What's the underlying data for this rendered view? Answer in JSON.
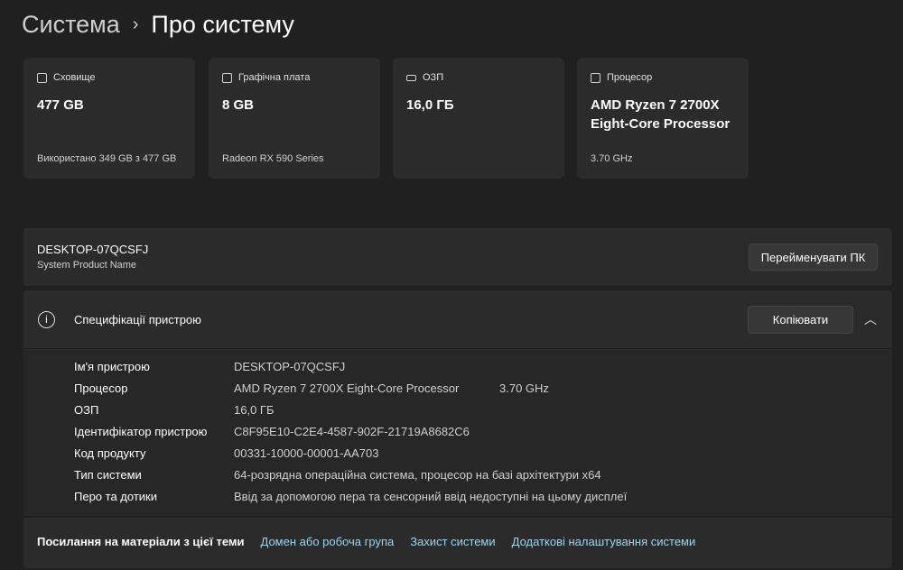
{
  "breadcrumb": {
    "parent": "Система",
    "current": "Про систему"
  },
  "cards": [
    {
      "icon": "storage-icon",
      "label": "Сховище",
      "value": "477 GB",
      "sub": "Використано 349 GB з 477 GB"
    },
    {
      "icon": "graphics-card-icon",
      "label": "Графічна плата",
      "value": "8 GB",
      "sub": "Radeon RX 590 Series"
    },
    {
      "icon": "ram-icon",
      "label": "ОЗП",
      "value": "16,0 ГБ",
      "sub": ""
    },
    {
      "icon": "processor-icon",
      "label": "Процесор",
      "value": "AMD Ryzen 7 2700X Eight-Core Processor",
      "sub": "3.70 GHz"
    }
  ],
  "device": {
    "name": "DESKTOP-07QCSFJ",
    "subtitle": "System Product Name",
    "rename_label": "Перейменувати ПК"
  },
  "specs": {
    "title": "Специфікації пристрою",
    "copy_label": "Копіювати",
    "rows": [
      {
        "label": "Ім'я пристрою",
        "value": "DESKTOP-07QCSFJ"
      },
      {
        "label": "Процесор",
        "value": "AMD Ryzen 7 2700X Eight-Core Processor",
        "extra": "3.70 GHz"
      },
      {
        "label": "ОЗП",
        "value": "16,0 ГБ"
      },
      {
        "label": "Ідентифікатор пристрою",
        "value": "C8F95E10-C2E4-4587-902F-21719A8682C6"
      },
      {
        "label": "Код продукту",
        "value": "00331-10000-00001-AA703"
      },
      {
        "label": "Тип системи",
        "value": "64-розрядна операційна система, процесор на базі архітектури x64"
      },
      {
        "label": "Перо та дотики",
        "value": "Ввід за допомогою пера та сенсорний ввід недоступні на цьому дисплеї"
      }
    ]
  },
  "related": {
    "title": "Посилання на матеріали з цієї теми",
    "links": [
      "Домен або робоча група",
      "Захист системи",
      "Додаткові налаштування системи"
    ]
  }
}
